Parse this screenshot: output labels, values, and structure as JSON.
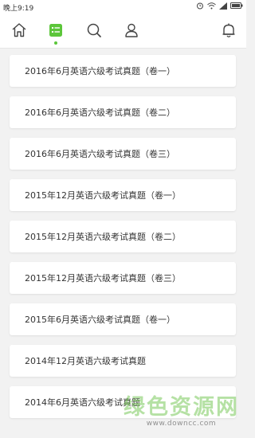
{
  "status_bar": {
    "time": "晚上9:19",
    "icons": [
      "alarm-icon",
      "wifi-icon",
      "signal-icon",
      "battery-icon"
    ]
  },
  "nav": {
    "icons": [
      "home-icon",
      "list-icon",
      "search-icon",
      "user-icon",
      "bell-icon"
    ],
    "active": "list-icon",
    "accent_color": "#5cc63a"
  },
  "list": {
    "items": [
      {
        "label": "2016年6月英语六级考试真题（卷一）"
      },
      {
        "label": "2016年6月英语六级考试真题（卷二）"
      },
      {
        "label": "2016年6月英语六级考试真题（卷三）"
      },
      {
        "label": "2015年12月英语六级考试真题（卷一）"
      },
      {
        "label": "2015年12月英语六级考试真题（卷二）"
      },
      {
        "label": "2015年12月英语六级考试真题（卷三）"
      },
      {
        "label": "2015年6月英语六级考试真题（卷一）"
      },
      {
        "label": "2014年12月英语六级考试真题"
      },
      {
        "label": "2014年6月英语六级考试真题"
      }
    ]
  },
  "watermark": {
    "main": "绿色资源网",
    "sub": "www.downcc.com"
  }
}
